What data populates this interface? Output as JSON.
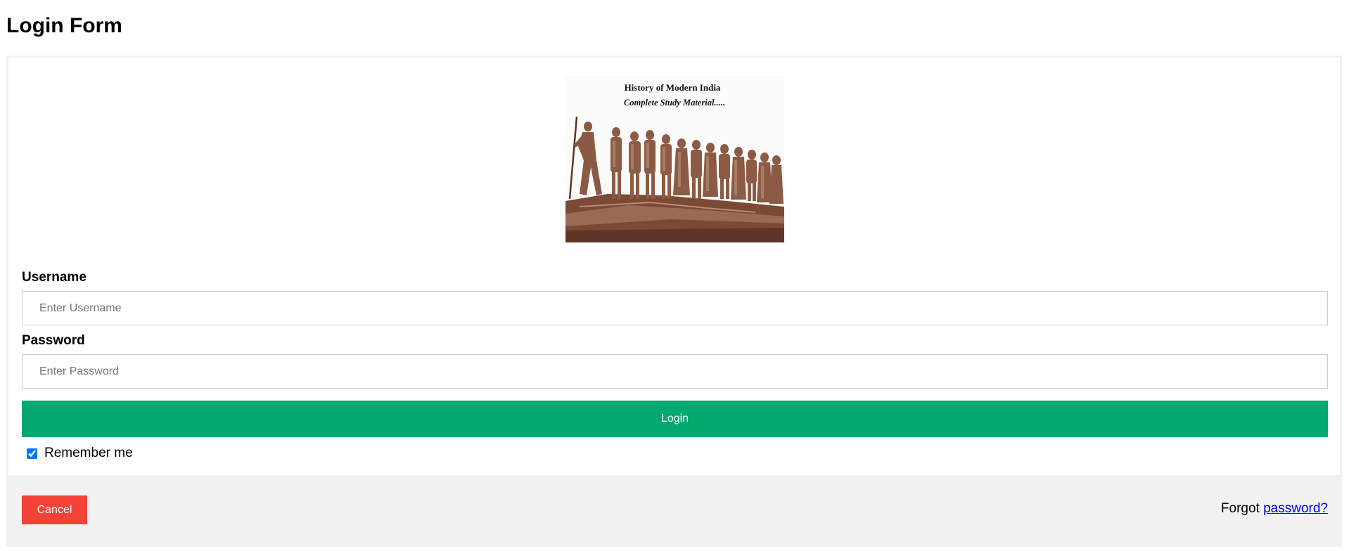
{
  "page": {
    "title": "Login Form"
  },
  "banner": {
    "line1": "History of Modern India",
    "line2": "Complete Study Material....."
  },
  "username": {
    "label": "Username",
    "placeholder": "Enter Username",
    "value": ""
  },
  "password": {
    "label": "Password",
    "placeholder": "Enter Password",
    "value": ""
  },
  "login_button": {
    "label": "Login"
  },
  "remember": {
    "label": "Remember me",
    "checked": true
  },
  "footer": {
    "cancel_label": "Cancel",
    "forgot_prefix": "Forgot",
    "forgot_link": "password?"
  },
  "colors": {
    "login_button": "#04aa6d",
    "cancel_button": "#f44336",
    "footer_bg": "#f1f1f1",
    "link": "#0000ee"
  }
}
